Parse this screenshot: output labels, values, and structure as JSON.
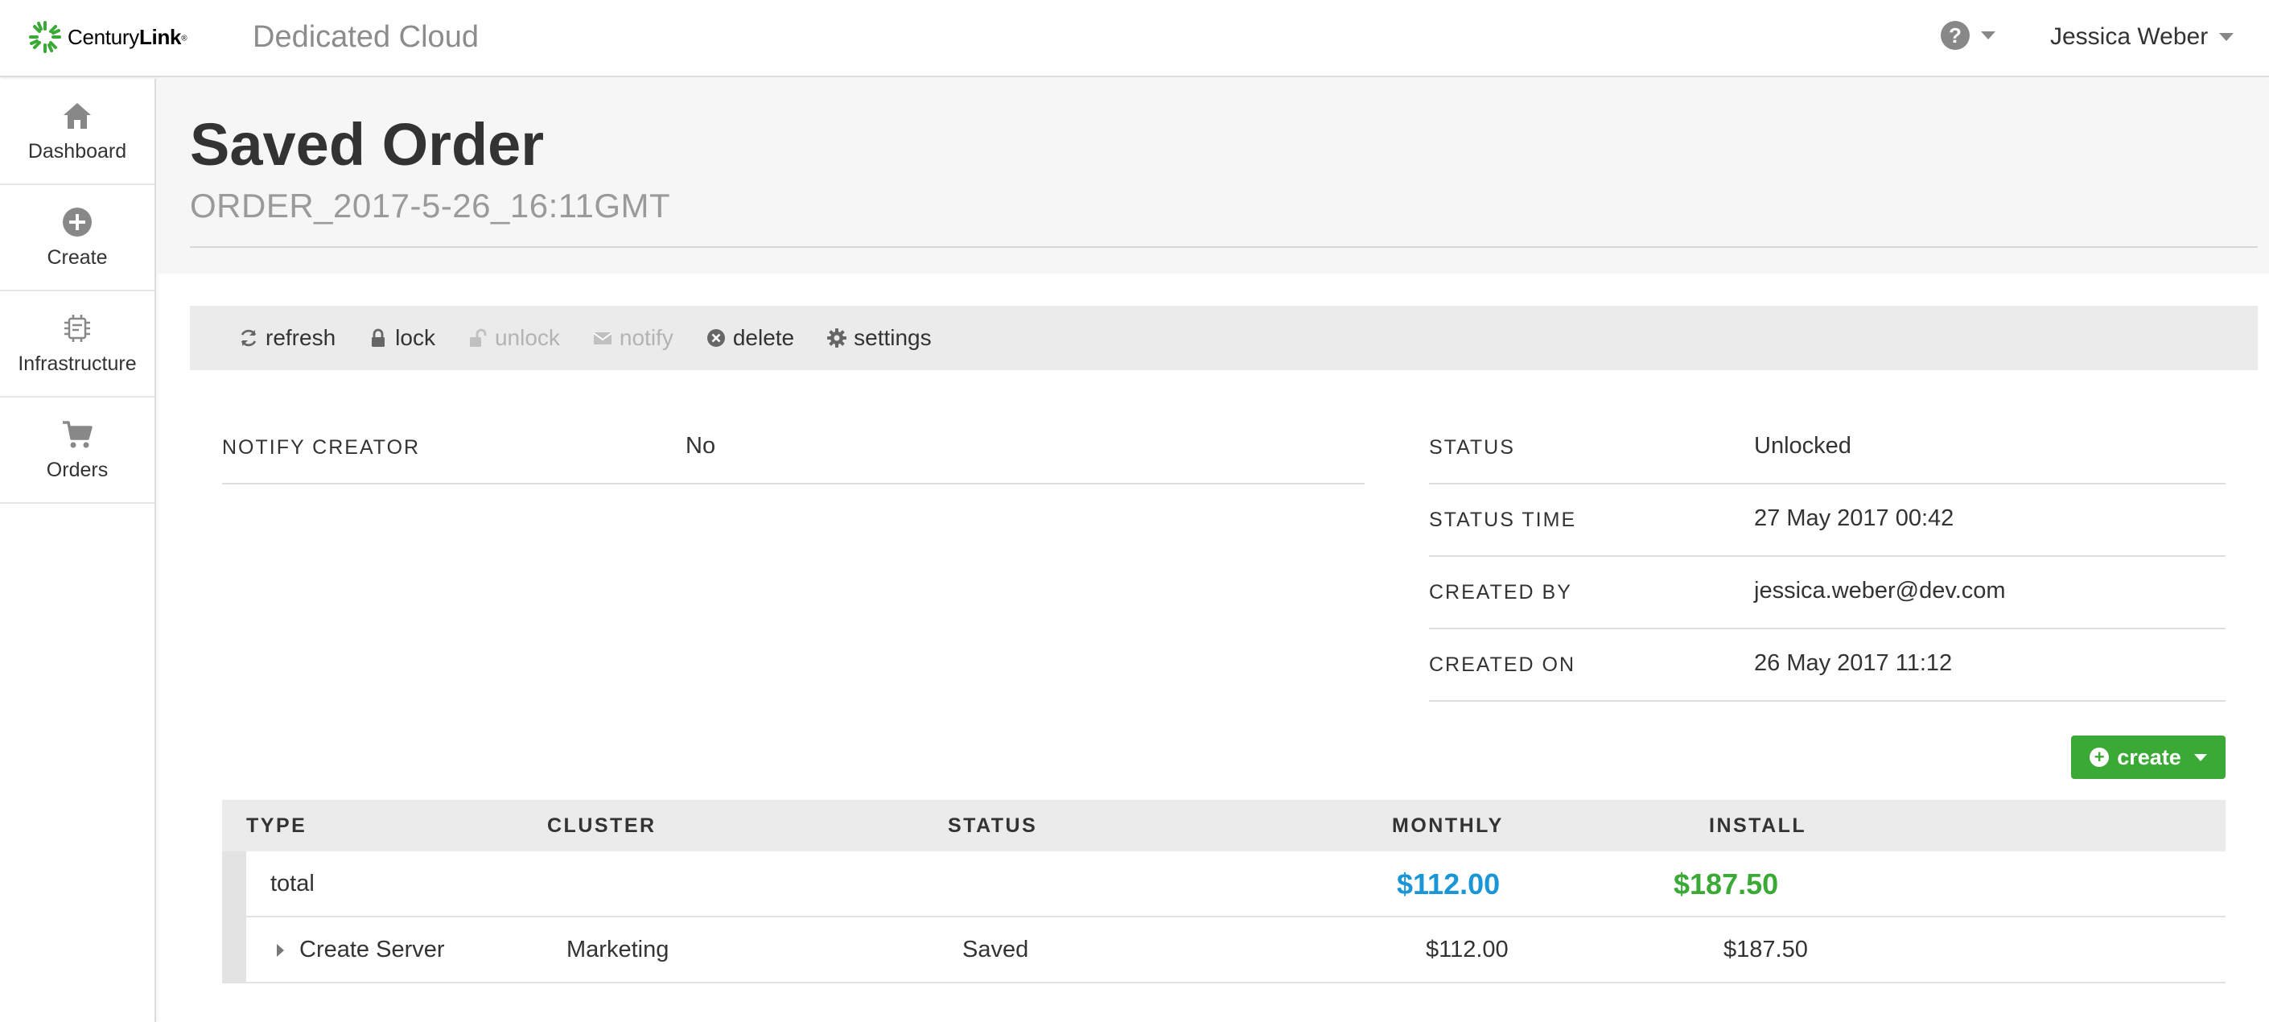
{
  "topbar": {
    "logo_prefix": "Century",
    "logo_bold": "Link",
    "app_title": "Dedicated Cloud",
    "help_symbol": "?",
    "user_name": "Jessica Weber"
  },
  "sidebar": {
    "items": [
      {
        "label": "Dashboard",
        "icon": "home-icon"
      },
      {
        "label": "Create",
        "icon": "plus-circle-icon"
      },
      {
        "label": "Infrastructure",
        "icon": "chip-icon"
      },
      {
        "label": "Orders",
        "icon": "cart-icon"
      }
    ]
  },
  "page": {
    "title": "Saved Order",
    "subtitle": "ORDER_2017-5-26_16:11GMT"
  },
  "toolbar": {
    "refresh": "refresh",
    "lock": "lock",
    "unlock": "unlock",
    "notify": "notify",
    "delete": "delete",
    "settings": "settings"
  },
  "details": {
    "notify_creator_label": "NOTIFY CREATOR",
    "notify_creator_value": "No",
    "status_label": "STATUS",
    "status_value": "Unlocked",
    "status_time_label": "STATUS TIME",
    "status_time_value": "27 May 2017 00:42",
    "created_by_label": "CREATED BY",
    "created_by_value": "jessica.weber@dev.com",
    "created_on_label": "CREATED ON",
    "created_on_value": "26 May 2017 11:12"
  },
  "create_button": {
    "label": "create"
  },
  "table": {
    "headers": {
      "type": "TYPE",
      "cluster": "CLUSTER",
      "status": "STATUS",
      "monthly": "MONTHLY",
      "install": "INSTALL"
    },
    "total": {
      "label": "total",
      "monthly": "$112.00",
      "install": "$187.50"
    },
    "rows": [
      {
        "type": "Create Server",
        "cluster": "Marketing",
        "status": "Saved",
        "monthly": "$112.00",
        "install": "$187.50"
      }
    ]
  },
  "colors": {
    "brand_green": "#3aa935",
    "monthly_blue": "#1a96d6",
    "install_green": "#3aa935",
    "icon_gray": "#888888"
  }
}
